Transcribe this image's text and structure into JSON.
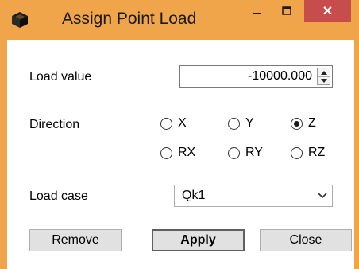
{
  "window": {
    "title": "Assign Point Load",
    "close_glyph": "✕",
    "icon": "cube-icon",
    "accent_color": "#f0a54a",
    "close_color": "#c74d4d"
  },
  "load_value": {
    "label": "Load value",
    "value": "-10000.000"
  },
  "direction": {
    "label": "Direction",
    "options": [
      {
        "label": "X",
        "selected": false
      },
      {
        "label": "Y",
        "selected": false
      },
      {
        "label": "Z",
        "selected": true
      },
      {
        "label": "RX",
        "selected": false
      },
      {
        "label": "RY",
        "selected": false
      },
      {
        "label": "RZ",
        "selected": false
      }
    ]
  },
  "load_case": {
    "label": "Load case",
    "selected": "Qk1"
  },
  "buttons": {
    "remove": "Remove",
    "apply": "Apply",
    "close": "Close"
  }
}
